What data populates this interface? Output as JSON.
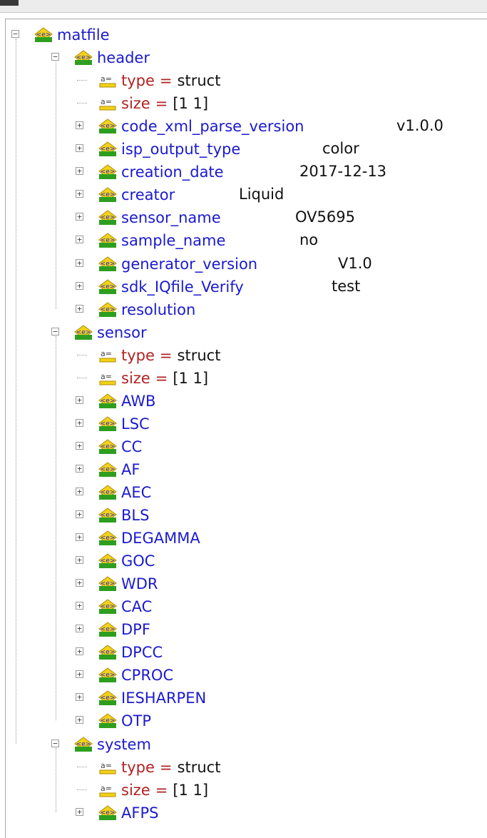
{
  "tree": {
    "root": {
      "label": "matfile"
    },
    "header": {
      "label": "header",
      "props": [
        {
          "label": "type",
          "eq": "=",
          "value": "struct"
        },
        {
          "label": "size",
          "eq": "=",
          "value": "[1 1]"
        }
      ],
      "children": [
        {
          "label": "code_xml_parse_version",
          "value": "v1.0.0"
        },
        {
          "label": "isp_output_type",
          "value": "color"
        },
        {
          "label": "creation_date",
          "value": "2017-12-13"
        },
        {
          "label": "creator",
          "value": "Liquid"
        },
        {
          "label": "sensor_name",
          "value": "OV5695"
        },
        {
          "label": "sample_name",
          "value": "no"
        },
        {
          "label": "generator_version",
          "value": "V1.0"
        },
        {
          "label": "sdk_IQfile_Verify",
          "value": "test"
        },
        {
          "label": "resolution",
          "value": ""
        }
      ]
    },
    "sensor": {
      "label": "sensor",
      "props": [
        {
          "label": "type",
          "eq": "=",
          "value": "struct"
        },
        {
          "label": "size",
          "eq": "=",
          "value": "[1 1]"
        }
      ],
      "children": [
        {
          "label": "AWB"
        },
        {
          "label": "LSC"
        },
        {
          "label": "CC"
        },
        {
          "label": "AF"
        },
        {
          "label": "AEC"
        },
        {
          "label": "BLS"
        },
        {
          "label": "DEGAMMA"
        },
        {
          "label": "GOC"
        },
        {
          "label": "WDR"
        },
        {
          "label": "CAC"
        },
        {
          "label": "DPF"
        },
        {
          "label": "DPCC"
        },
        {
          "label": "CPROC"
        },
        {
          "label": "IESHARPEN"
        },
        {
          "label": "OTP"
        }
      ]
    },
    "system": {
      "label": "system",
      "props": [
        {
          "label": "type",
          "eq": "=",
          "value": "struct"
        },
        {
          "label": "size",
          "eq": "=",
          "value": "[1 1]"
        }
      ],
      "children": [
        {
          "label": "AFPS"
        }
      ]
    }
  },
  "icons": {
    "element": "element-node-icon",
    "attribute": "attribute-node-icon"
  },
  "colors": {
    "element_text": "#1a1ad0",
    "attribute_text": "#b22222",
    "value_text": "#111111",
    "icon_green": "#2e9e1f",
    "icon_yellow": "#f2d21a"
  }
}
